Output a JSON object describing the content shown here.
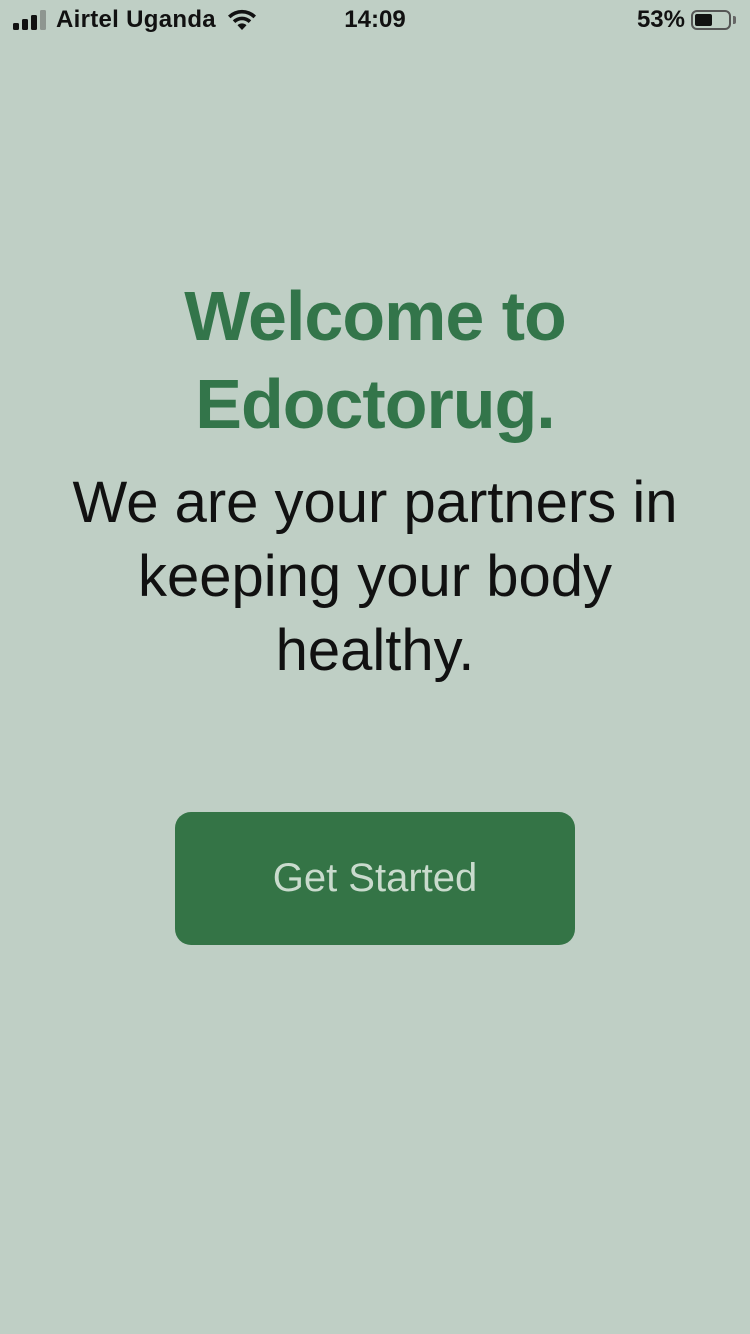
{
  "status_bar": {
    "carrier": "Airtel Uganda",
    "time": "14:09",
    "battery_percent": "53%",
    "battery_level": 0.53,
    "signal_bars_active": 3,
    "signal_bars_total": 4,
    "icons": [
      "signal-icon",
      "wifi-icon",
      "battery-icon"
    ]
  },
  "welcome": {
    "line1": "Welcome to",
    "line2": "Edoctorug."
  },
  "tagline": "We are your partners in keeping your body healthy.",
  "cta": {
    "label": "Get Started"
  },
  "colors": {
    "background": "#bfcfc5",
    "brand_green": "#33754a",
    "button_green": "#347446",
    "button_text": "#c9dbcd"
  }
}
